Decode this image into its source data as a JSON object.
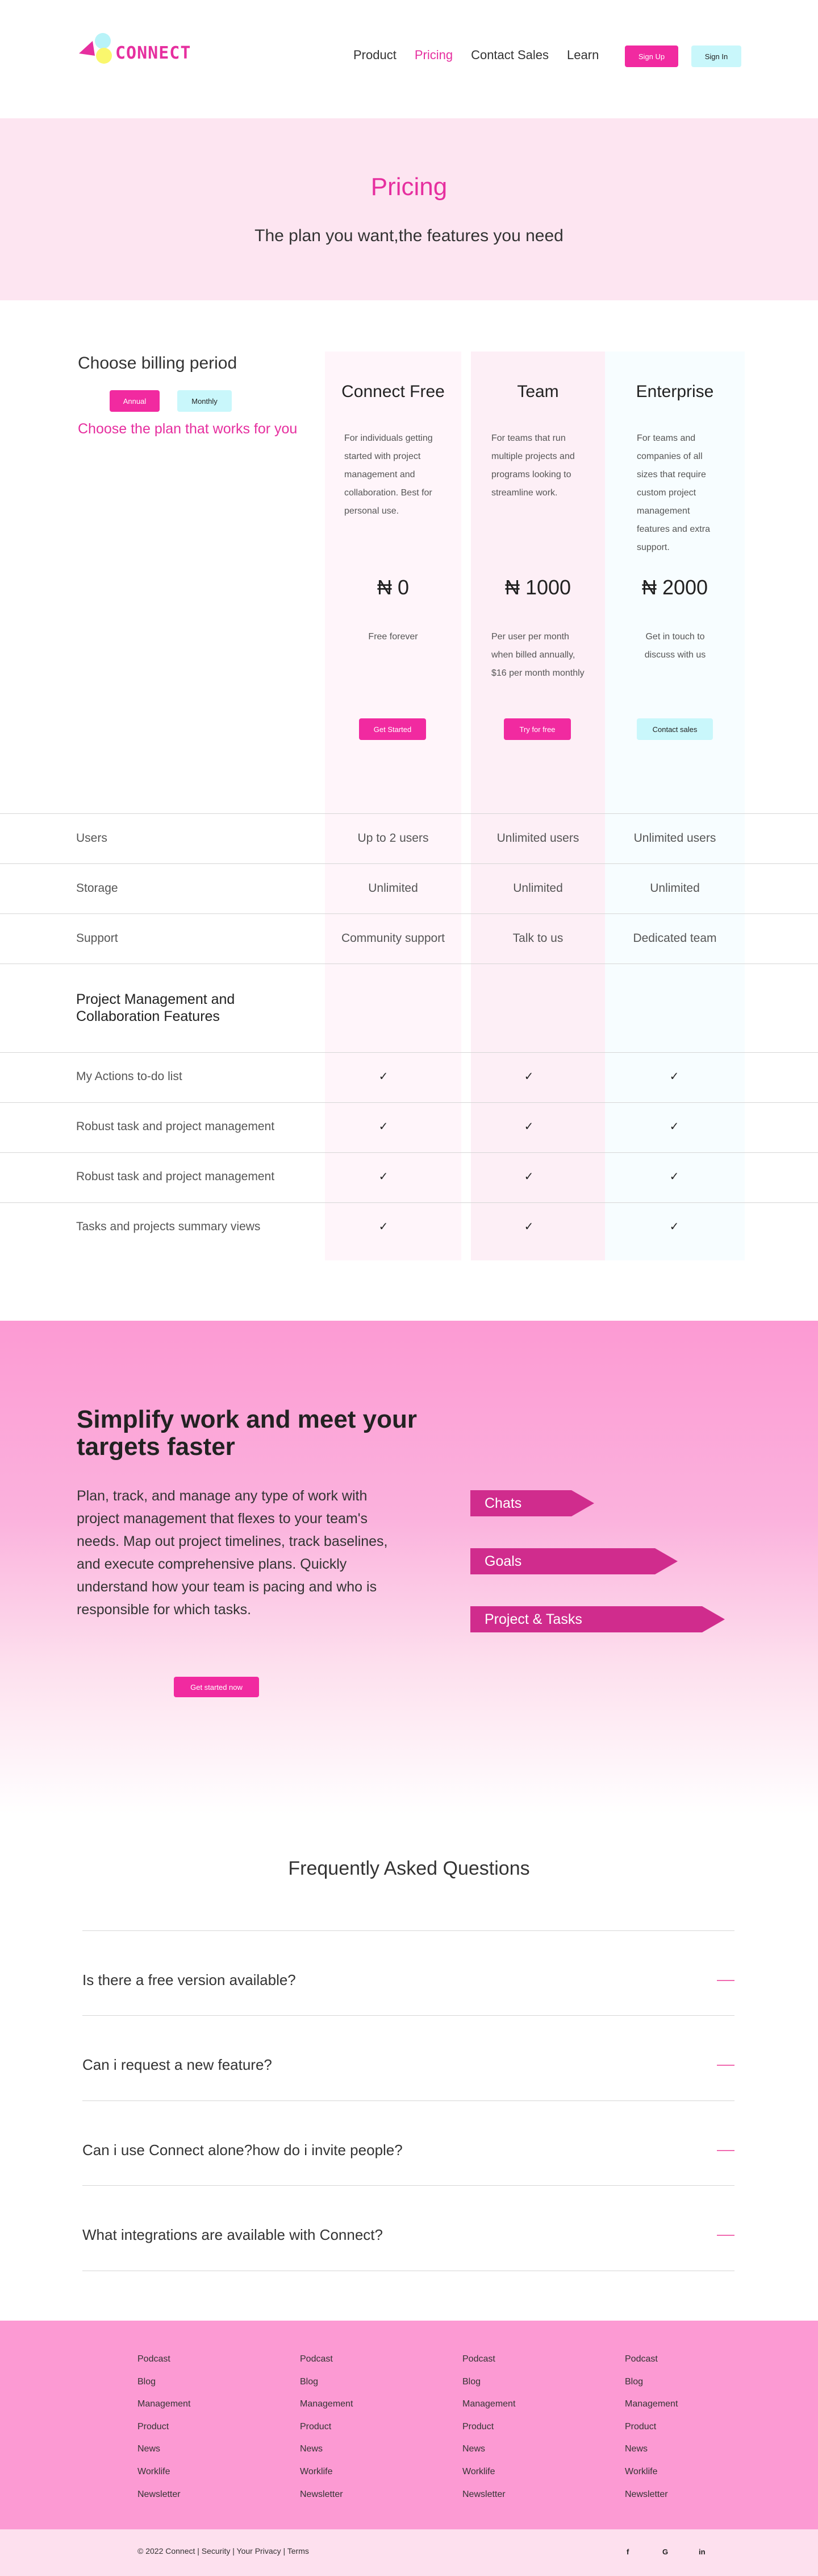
{
  "header": {
    "logo_text": "CONNECT",
    "nav": [
      "Product",
      "Pricing",
      "Contact Sales",
      "Learn"
    ],
    "active_nav": "Pricing",
    "signup_label": "Sign Up",
    "signin_label": "Sign In"
  },
  "hero": {
    "title": "Pricing",
    "subtitle": "The plan you want,the features you need"
  },
  "pricing": {
    "billing_title": "Choose billing period",
    "annual_label": "Annual",
    "monthly_label": "Monthly",
    "choose_plan": "Choose the plan that works for you",
    "plans": [
      {
        "name": "Connect Free",
        "description": "For individuals getting started with project management and collaboration. Best for personal use.",
        "price": "₦ 0",
        "note": "Free forever",
        "cta": "Get Started"
      },
      {
        "name": "Team",
        "description": "For teams that run multiple projects and programs looking to streamline work.",
        "price": "₦ 1000",
        "note": "Per user per month when billed annually, $16 per month monthly",
        "cta": "Try for free"
      },
      {
        "name": "Enterprise",
        "description": "For teams and companies of all sizes that require custom project management features and extra support.",
        "price": "₦ 2000",
        "note": "Get in touch to discuss with us",
        "cta": "Contact sales"
      }
    ],
    "rows": [
      {
        "label": "Users",
        "values": [
          "Up to 2 users",
          "Unlimited users",
          "Unlimited users"
        ]
      },
      {
        "label": "Storage",
        "values": [
          "Unlimited",
          "Unlimited",
          "Unlimited"
        ]
      },
      {
        "label": "Support",
        "values": [
          "Community support",
          "Talk to us",
          "Dedicated team"
        ]
      }
    ],
    "features_heading": "Project Management and Collaboration Features",
    "features": [
      {
        "label": "My Actions to-do list",
        "values": [
          "✓",
          "✓",
          "✓"
        ]
      },
      {
        "label": "Robust task and project management",
        "values": [
          "✓",
          "✓",
          "✓"
        ]
      },
      {
        "label": "Robust task and project management",
        "values": [
          "✓",
          "✓",
          "✓"
        ]
      },
      {
        "label": "Tasks and projects summary views",
        "values": [
          "✓",
          "✓",
          "✓"
        ]
      }
    ]
  },
  "simplify": {
    "title": "Simplify work and meet your targets faster",
    "body": "Plan, track, and manage any type of work with project management that flexes to your team's needs. Map out project timelines, track baselines, and execute comprehensive plans. Quickly understand how your team is pacing and who is responsible for which tasks.",
    "cta": "Get started now",
    "tags": [
      "Chats",
      "Goals",
      "Project & Tasks"
    ]
  },
  "faq": {
    "title": "Frequently Asked Questions",
    "questions": [
      "Is there a free version available?",
      "Can i request a new feature?",
      "Can i use Connect alone?how do i invite people?",
      "What integrations are available with Connect?"
    ]
  },
  "footer": {
    "columns": [
      [
        "Podcast",
        "Blog",
        "Management",
        "Product",
        "News",
        "Worklife",
        "Newsletter"
      ],
      [
        "Podcast",
        "Blog",
        "Management",
        "Product",
        "News",
        "Worklife",
        "Newsletter"
      ],
      [
        "Podcast",
        "Blog",
        "Management",
        "Product",
        "News",
        "Worklife",
        "Newsletter"
      ],
      [
        "Podcast",
        "Blog",
        "Management",
        "Product",
        "News",
        "Worklife",
        "Newsletter"
      ]
    ],
    "copyright": "© 2022 Connect | Security | Your Privacy | Terms",
    "social": [
      {
        "icon": "facebook-icon",
        "glyph": "f"
      },
      {
        "icon": "google-icon",
        "glyph": "G"
      },
      {
        "icon": "linkedin-icon",
        "glyph": "in"
      }
    ]
  },
  "colors": {
    "accent": "#e62f9f",
    "button_pink": "#f12aa0",
    "button_cyan": "#c9f7fb",
    "footer": "#fc9ad3",
    "tag": "#d02c8d"
  }
}
